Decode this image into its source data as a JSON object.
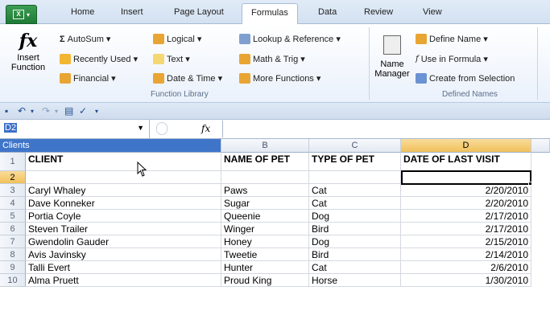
{
  "tabs": {
    "file": "",
    "home": "Home",
    "insert": "Insert",
    "page_layout": "Page Layout",
    "formulas": "Formulas",
    "data": "Data",
    "review": "Review",
    "view": "View"
  },
  "ribbon": {
    "insert_function_line1": "Insert",
    "insert_function_line2": "Function",
    "autosum": "AutoSum ▾",
    "recently_used": "Recently Used ▾",
    "financial": "Financial ▾",
    "logical": "Logical ▾",
    "text": "Text ▾",
    "date_time": "Date & Time ▾",
    "lookup_reference": "Lookup & Reference ▾",
    "math_trig": "Math & Trig ▾",
    "more_functions": "More Functions ▾",
    "function_library_label": "Function Library",
    "name_manager_line1": "Name",
    "name_manager_line2": "Manager",
    "define_name": "Define Name ▾",
    "use_in_formula": "Use in Formula ▾",
    "create_from_selection": "Create from Selection",
    "defined_names_label": "Defined Names"
  },
  "formula_bar": {
    "name_box": "D2",
    "fx": "fx",
    "value": ""
  },
  "grid": {
    "range_name": "Clients",
    "columns": [
      "B",
      "C",
      "D"
    ],
    "rows": [
      "1",
      "2",
      "3",
      "4",
      "5",
      "6",
      "7",
      "8",
      "9",
      "10"
    ],
    "header_row": [
      "CLIENT",
      "NAME OF PET",
      "TYPE OF PET",
      "DATE OF LAST VISIT"
    ],
    "data": [
      [
        "",
        "",
        "",
        ""
      ],
      [
        "Caryl Whaley",
        "Paws",
        "Cat",
        "2/20/2010"
      ],
      [
        "Dave Konneker",
        "Sugar",
        "Cat",
        "2/20/2010"
      ],
      [
        "Portia Coyle",
        "Queenie",
        "Dog",
        "2/17/2010"
      ],
      [
        "Steven Trailer",
        "Winger",
        "Bird",
        "2/17/2010"
      ],
      [
        "Gwendolin Gauder",
        "Honey",
        "Dog",
        "2/15/2010"
      ],
      [
        "Avis Javinsky",
        "Tweetie",
        "Bird",
        "2/14/2010"
      ],
      [
        "Talli Evert",
        "Hunter",
        "Cat",
        "2/6/2010"
      ],
      [
        "Alma Pruett",
        "Proud King",
        "Horse",
        "1/30/2010"
      ]
    ]
  },
  "colors": {
    "accent_blue": "#3f75c9",
    "selected_header": "#f1c15b",
    "file_green": "#1f7a35"
  }
}
